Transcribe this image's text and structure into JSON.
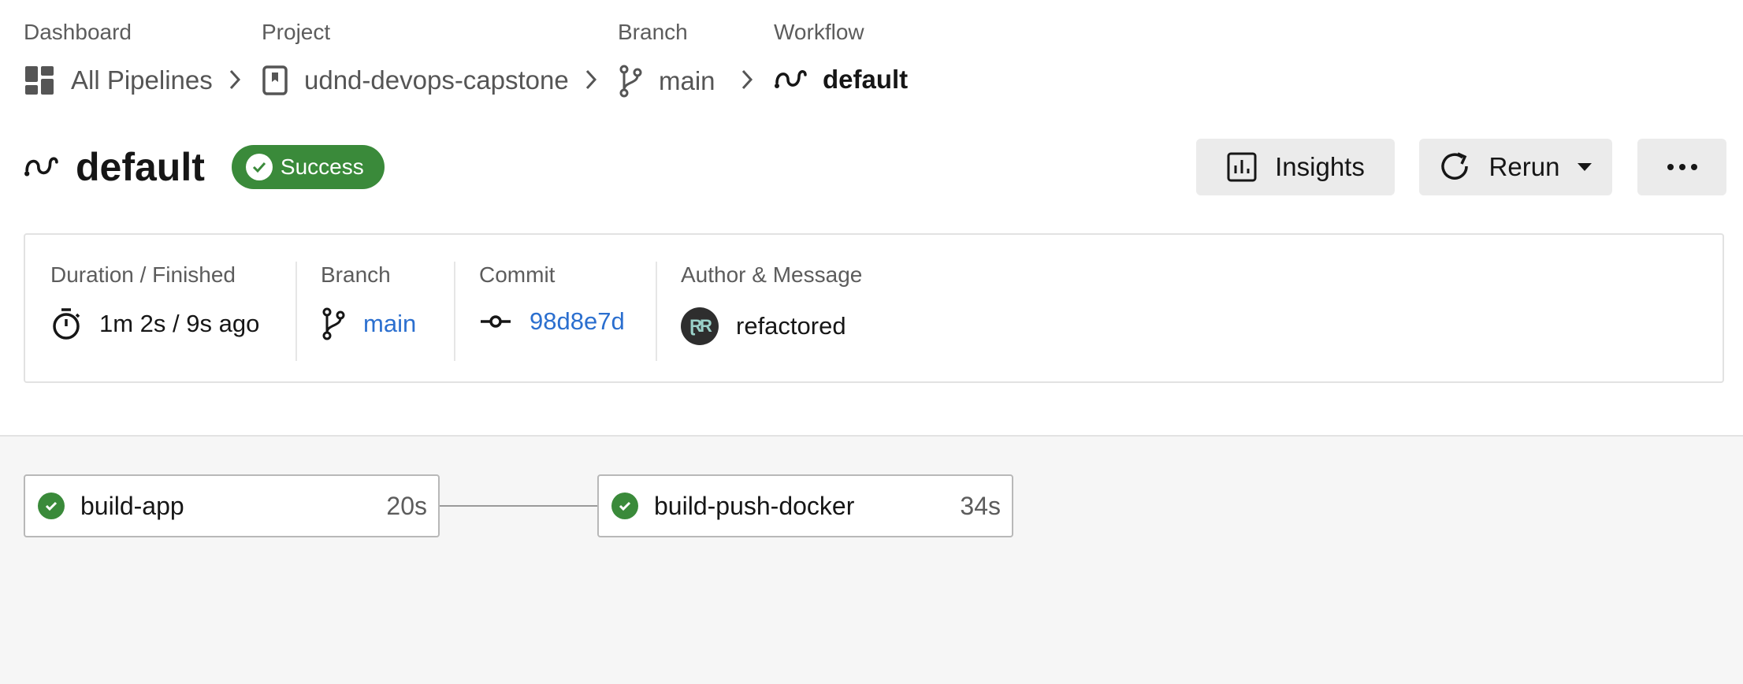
{
  "breadcrumb": {
    "dashboard_label": "Dashboard",
    "dashboard_value": "All Pipelines",
    "project_label": "Project",
    "project_value": "udnd-devops-capstone",
    "branch_label": "Branch",
    "branch_value": "main",
    "workflow_label": "Workflow",
    "workflow_value": "default"
  },
  "header": {
    "title": "default",
    "status": "Success",
    "status_color": "#3a8a3a"
  },
  "actions": {
    "insights": "Insights",
    "rerun": "Rerun"
  },
  "details": {
    "duration_label": "Duration / Finished",
    "duration_value": "1m 2s / 9s ago",
    "branch_label": "Branch",
    "branch_value": "main",
    "commit_label": "Commit",
    "commit_value": "98d8e7d",
    "author_label": "Author & Message",
    "author_message": "refactored",
    "link_color": "#2b6fcf"
  },
  "jobs": [
    {
      "name": "build-app",
      "duration": "20s",
      "status": "success"
    },
    {
      "name": "build-push-docker",
      "duration": "34s",
      "status": "success"
    }
  ],
  "icons": [
    "dashboard-icon",
    "chevron-right-icon",
    "bookmark-icon",
    "git-branch-icon",
    "workflow-icon",
    "check-icon",
    "bar-chart-icon",
    "refresh-icon",
    "caret-down-icon",
    "more-icon",
    "timer-icon",
    "commit-icon",
    "avatar"
  ]
}
